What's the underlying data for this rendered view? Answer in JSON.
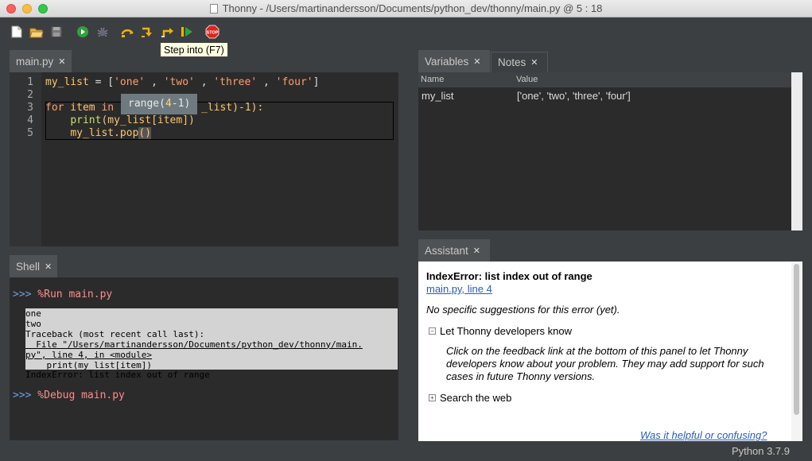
{
  "window": {
    "title": "Thonny  -  /Users/martinandersson/Documents/python_dev/thonny/main.py  @  5 : 18"
  },
  "toolbar": {
    "tooltip": "Step into (F7)",
    "stop_label": "STOP",
    "icons": [
      "new-file-icon",
      "open-file-icon",
      "save-icon",
      "run-icon",
      "debug-icon",
      "step-over-icon",
      "step-into-icon",
      "step-out-icon",
      "resume-icon",
      "stop-icon"
    ]
  },
  "editor": {
    "tab": "main.py",
    "lines": [
      "1",
      "2",
      "3",
      "4",
      "5"
    ],
    "code": {
      "l1": {
        "name": "my_list",
        "eq": " = [",
        "s1": "'one'",
        "s2": "'two'",
        "s3": "'three'",
        "s4": "'four'",
        "close": "]",
        "sep": " , "
      },
      "l3": {
        "kw_for": "for",
        "item": " item ",
        "kw_in": "in",
        "rest": "_list)-1):"
      },
      "l4": {
        "indent": "    ",
        "print": "print",
        "rest": "(my_list[item])"
      },
      "l5": {
        "indent": "    ",
        "rest": "my_list.pop",
        "paren": "()"
      }
    },
    "popup": {
      "pre": "range(",
      "hl": "4",
      "post": "-1)"
    }
  },
  "shell": {
    "tab": "Shell",
    "prompt": ">>>",
    "cmd1": " %Run main.py",
    "cmd2": " %Debug main.py",
    "output": [
      "one",
      "two",
      "Traceback (most recent call last):",
      "  File \"/Users/martinandersson/Documents/python_dev/thonny/main.",
      "py\", line 4, in <module>",
      "    print(my_list[item])",
      "IndexError: list index out of range"
    ]
  },
  "variables": {
    "tab": "Variables",
    "notes_tab": "Notes",
    "col_name": "Name",
    "col_value": "Value",
    "rows": [
      {
        "name": "my_list",
        "value": "['one', 'two', 'three', 'four']"
      }
    ]
  },
  "assistant": {
    "tab": "Assistant",
    "error_title": "IndexError: list index out of range",
    "error_link": "main.py, line 4",
    "no_suggestions": "No specific suggestions for this error (yet).",
    "let_know": "Let Thonny developers know",
    "let_know_body": "Click on the feedback link at the bottom of this panel to let Thonny developers know about your problem. They may add support for such cases in future Thonny versions.",
    "search_web": "Search the web",
    "helpful": "Was it helpful or confusing?"
  },
  "status": {
    "python_version": "Python 3.7.9"
  }
}
